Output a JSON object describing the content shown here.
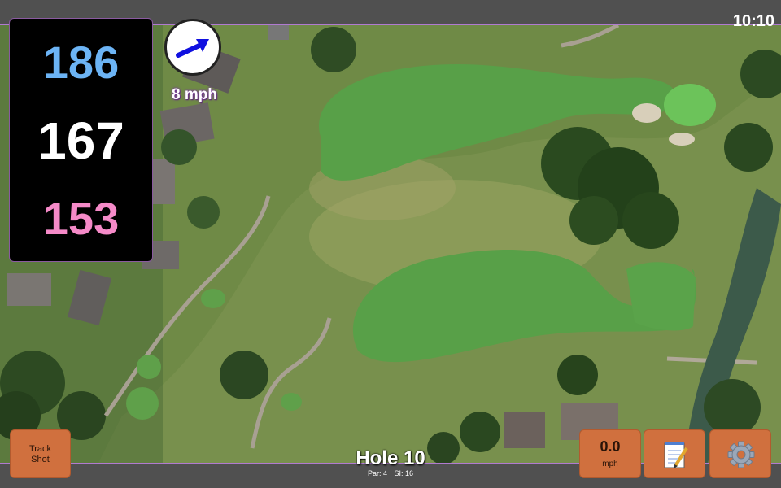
{
  "status": {
    "time": "10:10"
  },
  "yardages": {
    "back": "186",
    "middle": "167",
    "front": "153"
  },
  "colors": {
    "back": "#6cb4f5",
    "middle": "#ffffff",
    "front": "#f58ac8",
    "button": "#d0703e",
    "wind_arrow": "#1010e0"
  },
  "wind": {
    "speed_label": "8 mph"
  },
  "buttons": {
    "track_shot_line1": "Track",
    "track_shot_line2": "Shot",
    "wind_value": "0.0",
    "wind_unit": "mph"
  },
  "icons": {
    "notes": "notepad-icon",
    "settings": "gear-icon"
  },
  "hole": {
    "title": "Hole 10",
    "par": "Par: 4",
    "si": "SI: 16"
  }
}
